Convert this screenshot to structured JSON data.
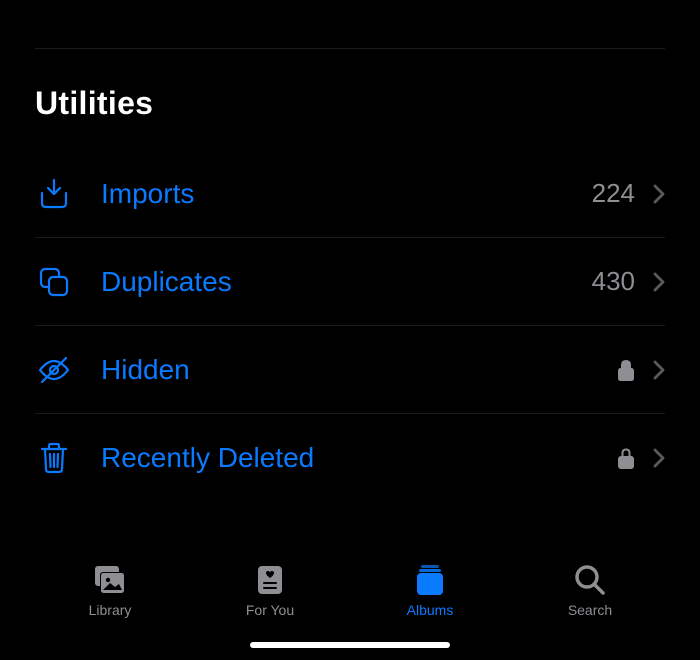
{
  "section": {
    "title": "Utilities",
    "items": [
      {
        "label": "Imports",
        "count": "224",
        "locked": false,
        "icon": "import-icon"
      },
      {
        "label": "Duplicates",
        "count": "430",
        "locked": false,
        "icon": "duplicates-icon"
      },
      {
        "label": "Hidden",
        "count": "",
        "locked": true,
        "icon": "hidden-icon"
      },
      {
        "label": "Recently Deleted",
        "count": "",
        "locked": true,
        "icon": "trash-icon"
      }
    ]
  },
  "tabs": {
    "items": [
      {
        "label": "Library",
        "active": false
      },
      {
        "label": "For You",
        "active": false
      },
      {
        "label": "Albums",
        "active": true
      },
      {
        "label": "Search",
        "active": false
      }
    ]
  },
  "colors": {
    "accent": "#0a7aff",
    "secondaryText": "#8e8e93",
    "divider": "#1c1c1e"
  }
}
